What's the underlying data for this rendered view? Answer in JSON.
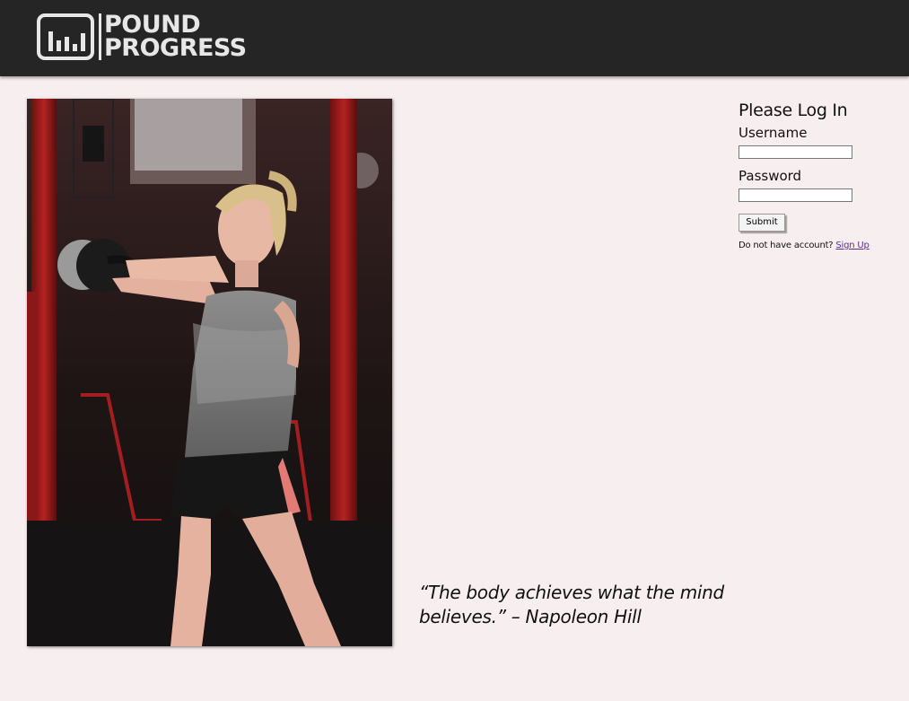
{
  "header": {
    "logo_line1": "POUND",
    "logo_line2": "PROGRESS",
    "logo_icon": "bar-chart-icon"
  },
  "hero": {
    "alt": "Woman training with a kettlebell in a gym"
  },
  "quote": {
    "text": "“The body achieves what the mind believes.” – Napoleon Hill"
  },
  "login": {
    "title": "Please Log In",
    "username_label": "Username",
    "username_value": "",
    "password_label": "Password",
    "password_value": "",
    "submit_label": "Submit",
    "signup_prompt": "Do not have account?",
    "signup_link": "Sign Up"
  },
  "colors": {
    "header_bg": "#252525",
    "page_bg": "#f7eeef",
    "link": "#5b2c8f"
  }
}
